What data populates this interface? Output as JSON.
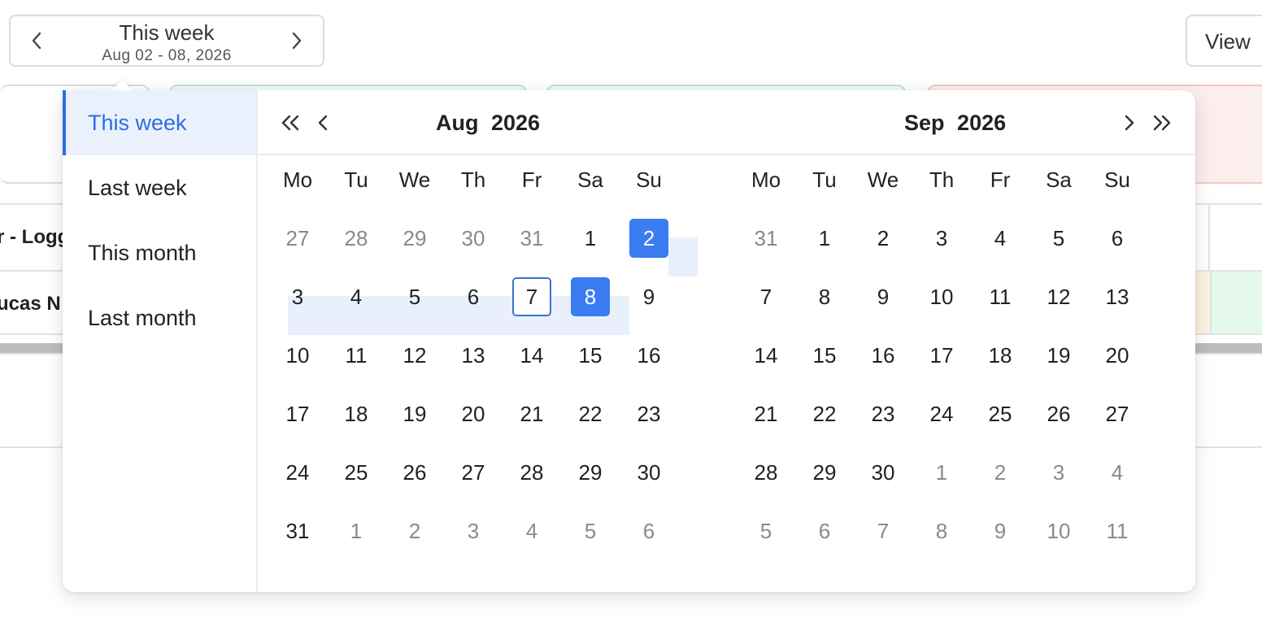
{
  "week_nav": {
    "title": "This week",
    "subtitle": "Aug 02 - 08, 2026"
  },
  "view_button": {
    "label": "View"
  },
  "background": {
    "header_cell_text": "r - Logg",
    "row_cell_text": "ucas N"
  },
  "presets": [
    {
      "label": "This week",
      "active": true
    },
    {
      "label": "Last week",
      "active": false
    },
    {
      "label": "This month",
      "active": false
    },
    {
      "label": "Last month",
      "active": false
    }
  ],
  "weekdays": [
    "Mo",
    "Tu",
    "We",
    "Th",
    "Fr",
    "Sa",
    "Su"
  ],
  "months": [
    {
      "month": "Aug",
      "year": "2026",
      "weeks": [
        [
          {
            "d": "27",
            "m": true
          },
          {
            "d": "28",
            "m": true
          },
          {
            "d": "29",
            "m": true
          },
          {
            "d": "30",
            "m": true
          },
          {
            "d": "31",
            "m": true
          },
          {
            "d": "1"
          },
          {
            "d": "2",
            "sel": true
          }
        ],
        [
          {
            "d": "3"
          },
          {
            "d": "4"
          },
          {
            "d": "5"
          },
          {
            "d": "6"
          },
          {
            "d": "7",
            "today": true
          },
          {
            "d": "8",
            "sel": true
          },
          {
            "d": "9"
          }
        ],
        [
          {
            "d": "10"
          },
          {
            "d": "11"
          },
          {
            "d": "12"
          },
          {
            "d": "13"
          },
          {
            "d": "14"
          },
          {
            "d": "15"
          },
          {
            "d": "16"
          }
        ],
        [
          {
            "d": "17"
          },
          {
            "d": "18"
          },
          {
            "d": "19"
          },
          {
            "d": "20"
          },
          {
            "d": "21"
          },
          {
            "d": "22"
          },
          {
            "d": "23"
          }
        ],
        [
          {
            "d": "24"
          },
          {
            "d": "25"
          },
          {
            "d": "26"
          },
          {
            "d": "27"
          },
          {
            "d": "28"
          },
          {
            "d": "29"
          },
          {
            "d": "30"
          }
        ],
        [
          {
            "d": "31"
          },
          {
            "d": "1",
            "m": true
          },
          {
            "d": "2",
            "m": true
          },
          {
            "d": "3",
            "m": true
          },
          {
            "d": "4",
            "m": true
          },
          {
            "d": "5",
            "m": true
          },
          {
            "d": "6",
            "m": true
          }
        ]
      ]
    },
    {
      "month": "Sep",
      "year": "2026",
      "weeks": [
        [
          {
            "d": "31",
            "m": true
          },
          {
            "d": "1"
          },
          {
            "d": "2"
          },
          {
            "d": "3"
          },
          {
            "d": "4"
          },
          {
            "d": "5"
          },
          {
            "d": "6"
          }
        ],
        [
          {
            "d": "7"
          },
          {
            "d": "8"
          },
          {
            "d": "9"
          },
          {
            "d": "10"
          },
          {
            "d": "11"
          },
          {
            "d": "12"
          },
          {
            "d": "13"
          }
        ],
        [
          {
            "d": "14"
          },
          {
            "d": "15"
          },
          {
            "d": "16"
          },
          {
            "d": "17"
          },
          {
            "d": "18"
          },
          {
            "d": "19"
          },
          {
            "d": "20"
          }
        ],
        [
          {
            "d": "21"
          },
          {
            "d": "22"
          },
          {
            "d": "23"
          },
          {
            "d": "24"
          },
          {
            "d": "25"
          },
          {
            "d": "26"
          },
          {
            "d": "27"
          }
        ],
        [
          {
            "d": "28"
          },
          {
            "d": "29"
          },
          {
            "d": "30"
          },
          {
            "d": "1",
            "m": true
          },
          {
            "d": "2",
            "m": true
          },
          {
            "d": "3",
            "m": true
          },
          {
            "d": "4",
            "m": true
          }
        ],
        [
          {
            "d": "5",
            "m": true
          },
          {
            "d": "6",
            "m": true
          },
          {
            "d": "7",
            "m": true
          },
          {
            "d": "8",
            "m": true
          },
          {
            "d": "9",
            "m": true
          },
          {
            "d": "10",
            "m": true
          },
          {
            "d": "11",
            "m": true
          }
        ]
      ]
    }
  ],
  "colors": {
    "accent": "#3b7cf0",
    "range_bg": "#e9f0fc",
    "preset_active_text": "#2c6fe0",
    "muted_text": "#8a8a8a"
  }
}
